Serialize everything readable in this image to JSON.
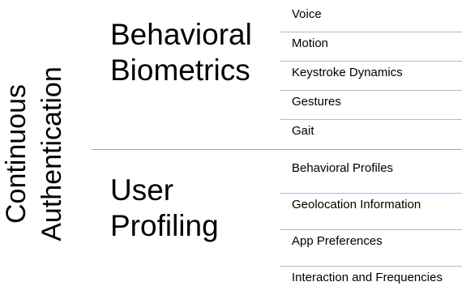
{
  "title": {
    "line1": "Continuous",
    "line2": "Authentication"
  },
  "categories": [
    {
      "line1": "Behavioral",
      "line2": "Biometrics",
      "items": [
        "Voice",
        "Motion",
        "Keystroke Dynamics",
        "Gestures",
        "Gait"
      ]
    },
    {
      "line1": "User",
      "line2": "Profiling",
      "items": [
        "Behavioral Profiles",
        "Geolocation Information",
        "App Preferences",
        "Interaction and Frequencies"
      ]
    }
  ],
  "colors": {
    "item_separator": "#b4b4de",
    "group_divider": "#a6a6a6",
    "text": "#000000"
  }
}
